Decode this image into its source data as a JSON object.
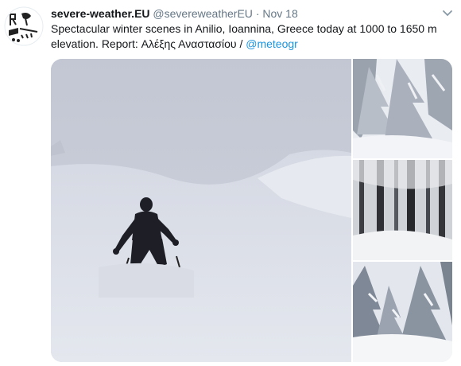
{
  "tweet": {
    "author_name": "severe-weather.EU",
    "author_handle": "@severeweatherEU",
    "separator": "·",
    "date": "Nov 18",
    "text_main": "Spectacular winter scenes in Anilio, Ioannina, Greece today at 1000 to 1650 m elevation. Report: Αλέξης Αναστασίου / ",
    "mention": "@meteogr"
  },
  "icons": {
    "avatar": "severe-weather-logo",
    "caret": "chevron-down-icon"
  },
  "colors": {
    "link": "#1b95e0",
    "secondary_text": "#657786",
    "primary_text": "#14171a"
  }
}
